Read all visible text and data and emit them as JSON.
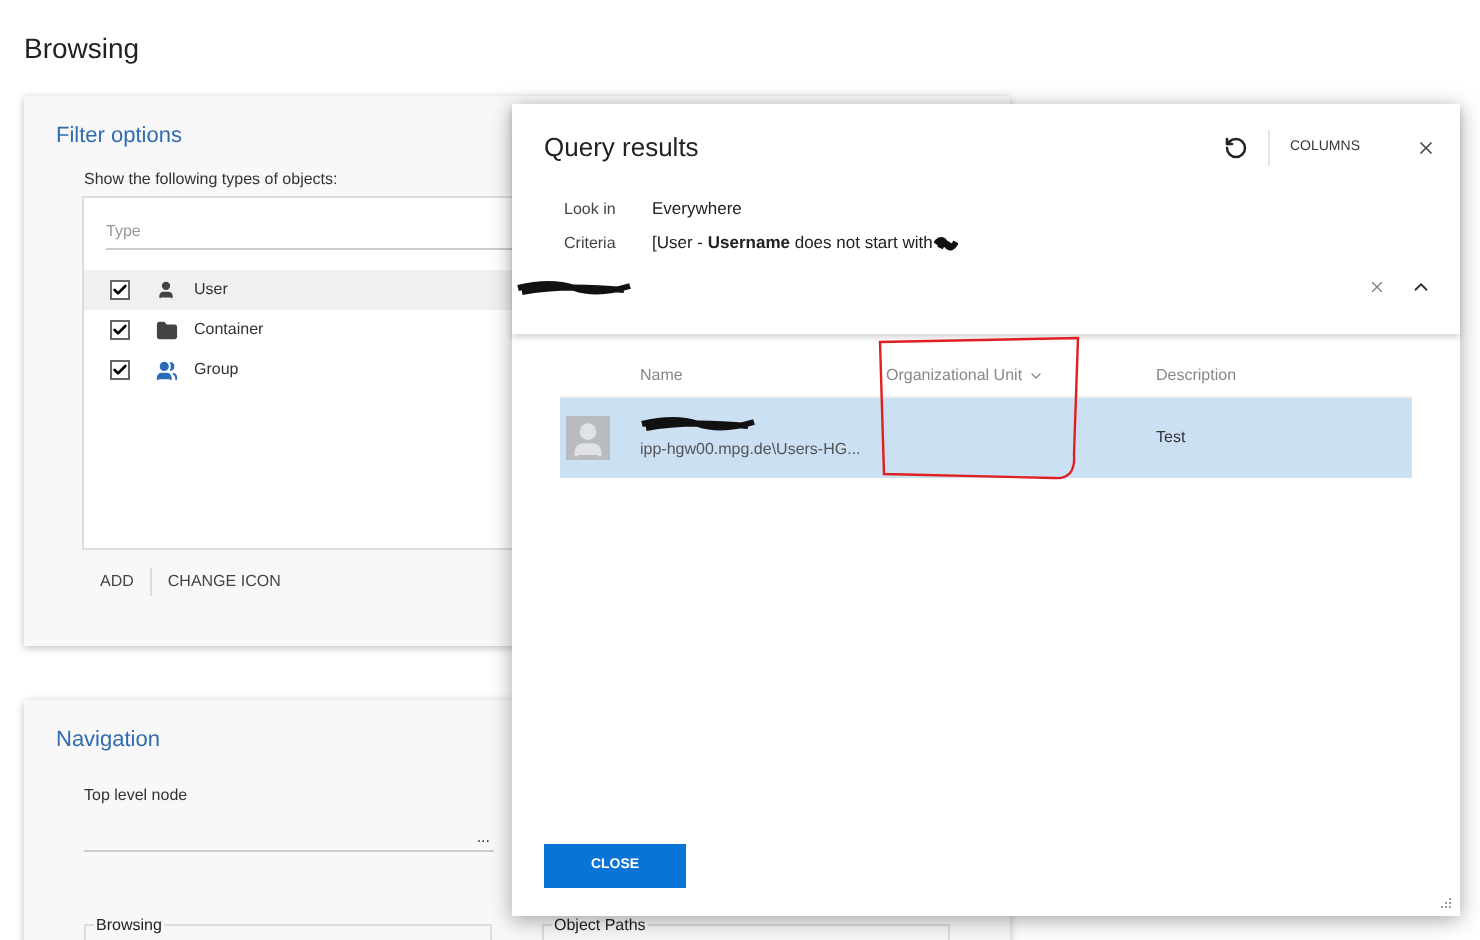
{
  "page": {
    "title": "Browsing"
  },
  "filter_options": {
    "title": "Filter options",
    "label": "Show the following types of objects:",
    "field": {
      "placeholder": "Type"
    },
    "types": [
      {
        "label": "User",
        "kind": "user",
        "checked": true,
        "selected": true
      },
      {
        "label": "Container",
        "kind": "folder",
        "checked": true,
        "selected": false
      },
      {
        "label": "Group",
        "kind": "group",
        "checked": true,
        "selected": false
      }
    ],
    "actions": [
      "ADD",
      "CHANGE ICON"
    ]
  },
  "navigation": {
    "title": "Navigation",
    "top_level_node_label": "Top level node",
    "browse_button": "...",
    "groups": [
      "Browsing",
      "Object Paths"
    ]
  },
  "dialog": {
    "title": "Query results",
    "columns_button": "COLUMNS",
    "fields": [
      {
        "label": "Look in",
        "value": "Everywhere"
      },
      {
        "label": "Criteria",
        "value": "[User - **Username** does not start with"
      }
    ],
    "table": {
      "columns": [
        {
          "label": "Name",
          "sorted": false
        },
        {
          "label": "Organizational Unit",
          "sorted": true
        },
        {
          "label": "Description",
          "sorted": false
        }
      ],
      "rows": [
        {
          "path": "ipp-hgw00.mpg.de\\Users-HG...",
          "description": "Test",
          "selected": true
        }
      ]
    },
    "close_button": "CLOSE"
  }
}
